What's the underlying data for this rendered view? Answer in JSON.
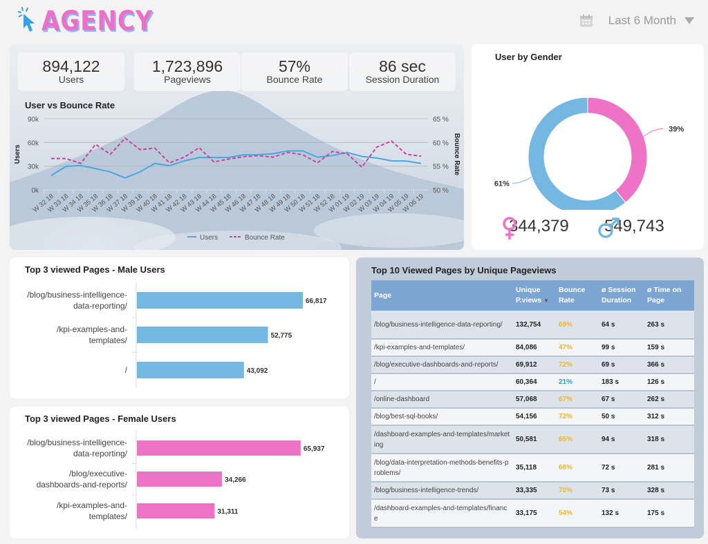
{
  "header": {
    "logo_text": "AGENCY",
    "logo_icon": "cursor-click-icon",
    "date_filter": {
      "icon": "calendar-icon",
      "label": "Last 6 Month",
      "caret": "caret-down-icon"
    }
  },
  "kpis": [
    {
      "value": "894,122",
      "label": "Users"
    },
    {
      "value": "1,723,896",
      "label": "Pageviews"
    },
    {
      "value": "57%",
      "label": "Bounce Rate"
    },
    {
      "value": "86 sec",
      "label": "Session Duration"
    }
  ],
  "colors": {
    "male": "#74b8e2",
    "female": "#ee72c6",
    "users_line": "#4aa6e0",
    "bounce_line": "#c8439e",
    "bounce_warn": "#f0b431",
    "bounce_good": "#2aa0c8",
    "table_header": "#7da5d4"
  },
  "chart_data": [
    {
      "id": "user-vs-bounce",
      "type": "line",
      "title": "User vs Bounce Rate",
      "xlabel": "",
      "ylabel": "Users",
      "y2label": "Bounce Rate",
      "ylim": [
        0,
        90000
      ],
      "y2lim": [
        50,
        65
      ],
      "yticks": [
        "0k",
        "30k",
        "60k",
        "90k"
      ],
      "y2ticks": [
        "50 %",
        "55 %",
        "60 %",
        "65 %"
      ],
      "grid": true,
      "legend": "bottom",
      "categories": [
        "W 32 18",
        "W 33 18",
        "W 34 18",
        "W 35 18",
        "W 36 18",
        "W 37 18",
        "W 39 18",
        "W 40 18",
        "W 41 18",
        "W 42 18",
        "W 43 18",
        "W 44 18",
        "W 45 18",
        "W 46 18",
        "W 47 18",
        "W 48 18",
        "W 49 18",
        "W 50 18",
        "W 51 18",
        "W 52 18",
        "W 01 19",
        "W 02 19",
        "W 03 19",
        "W 04 19",
        "W 05 19",
        "W 06 19"
      ],
      "series": [
        {
          "name": "Users",
          "axis": "left",
          "style": "solid",
          "values": [
            18000,
            29700,
            30800,
            26900,
            22700,
            15000,
            22700,
            33400,
            30500,
            36700,
            40900,
            41000,
            41000,
            44300,
            44500,
            45800,
            49300,
            49300,
            41400,
            43300,
            47300,
            42300,
            40300,
            36700,
            36500,
            33400
          ]
        },
        {
          "name": "Bounce Rate",
          "axis": "right",
          "style": "dashed",
          "values": [
            56.6,
            56.6,
            55.6,
            59.6,
            57.5,
            60.9,
            58.5,
            58.8,
            55.7,
            56.9,
            58.9,
            55.9,
            56.5,
            57.0,
            57.2,
            56.9,
            57.9,
            57.4,
            55.7,
            58.1,
            57.6,
            54.8,
            59.0,
            60.3,
            57.5,
            57.1
          ]
        }
      ]
    },
    {
      "id": "user-by-gender",
      "type": "pie",
      "title": "User by Gender",
      "donut": true,
      "slices": [
        {
          "name": "Female",
          "value": 39,
          "label": "39%"
        },
        {
          "name": "Male",
          "value": 61,
          "label": "61%"
        }
      ]
    },
    {
      "id": "top3-male",
      "type": "bar",
      "orientation": "horizontal",
      "title": "Top 3 viewed Pages - Male Users",
      "categories": [
        "/blog/business-intelligence-data-reporting/",
        "/kpi-examples-and-templates/",
        "/"
      ],
      "category_lines": [
        [
          "/blog/business-intelligence-",
          "data-reporting/"
        ],
        [
          "/kpi-examples-and-",
          "templates/"
        ],
        [
          "/"
        ]
      ],
      "values": [
        66817,
        52775,
        43092
      ],
      "value_labels": [
        "66,817",
        "52,775",
        "43,092"
      ]
    },
    {
      "id": "top3-female",
      "type": "bar",
      "orientation": "horizontal",
      "title": "Top 3 viewed Pages - Female Users",
      "categories": [
        "/blog/business-intelligence-data-reporting/",
        "/blog/executive-dashboards-and-reports/",
        "/kpi-examples-and-templates/"
      ],
      "category_lines": [
        [
          "/blog/business-intelligence-",
          "data-reporting/"
        ],
        [
          "/blog/executive-",
          "dashboards-and-reports/"
        ],
        [
          "/kpi-examples-and-",
          "templates/"
        ]
      ],
      "values": [
        65937,
        34266,
        31311
      ],
      "value_labels": [
        "65,937",
        "34,266",
        "31,311"
      ]
    }
  ],
  "gender": {
    "title": "User by Gender",
    "female_icon": "female-symbol-icon",
    "female_count": "344,379",
    "male_icon": "male-symbol-icon",
    "male_count": "549,743"
  },
  "table": {
    "title": "Top 10 Viewed Pages by Unique Pageviews",
    "columns": [
      "Page",
      "Unique P.views",
      "Bounce Rate",
      "ø  Session Duration",
      "ø Time on Page"
    ],
    "sort_column": "Unique P.views",
    "sort_icon": "sort-desc-icon",
    "rows": [
      {
        "page": "/blog/business-intelligence-data-reporting/",
        "views": "132,754",
        "bounce": "69%",
        "bounce_color": "warn",
        "session": "64 s",
        "time": "263 s"
      },
      {
        "page": "/kpi-examples-and-templates/",
        "views": "84,086",
        "bounce": "47%",
        "bounce_color": "warn",
        "session": "99 s",
        "time": "159 s"
      },
      {
        "page": "/blog/executive-dashboards-and-reports/",
        "views": "69,912",
        "bounce": "72%",
        "bounce_color": "warn",
        "session": "69 s",
        "time": "366 s"
      },
      {
        "page": "/",
        "views": "60,364",
        "bounce": "21%",
        "bounce_color": "good",
        "session": "183 s",
        "time": "126 s"
      },
      {
        "page": "/online-dashboard",
        "views": "57,068",
        "bounce": "67%",
        "bounce_color": "warn",
        "session": "67 s",
        "time": "262 s"
      },
      {
        "page": "/blog/best-sql-books/",
        "views": "54,156",
        "bounce": "72%",
        "bounce_color": "warn",
        "session": "50 s",
        "time": "312 s"
      },
      {
        "page": "/dashboard-examples-and-templates/marketing",
        "views": "50,581",
        "bounce": "65%",
        "bounce_color": "warn",
        "session": "94 s",
        "time": "318 s"
      },
      {
        "page": "/blog/data-interpretation-methods-benefits-problems/",
        "views": "35,118",
        "bounce": "68%",
        "bounce_color": "warn",
        "session": "72 s",
        "time": "281 s"
      },
      {
        "page": "/blog/business-intelligence-trends/",
        "views": "33,335",
        "bounce": "70%",
        "bounce_color": "warn",
        "session": "73 s",
        "time": "328 s"
      },
      {
        "page": "/dashboard-examples-and-templates/finance",
        "views": "33,175",
        "bounce": "54%",
        "bounce_color": "warn",
        "session": "132 s",
        "time": "175 s"
      }
    ]
  }
}
